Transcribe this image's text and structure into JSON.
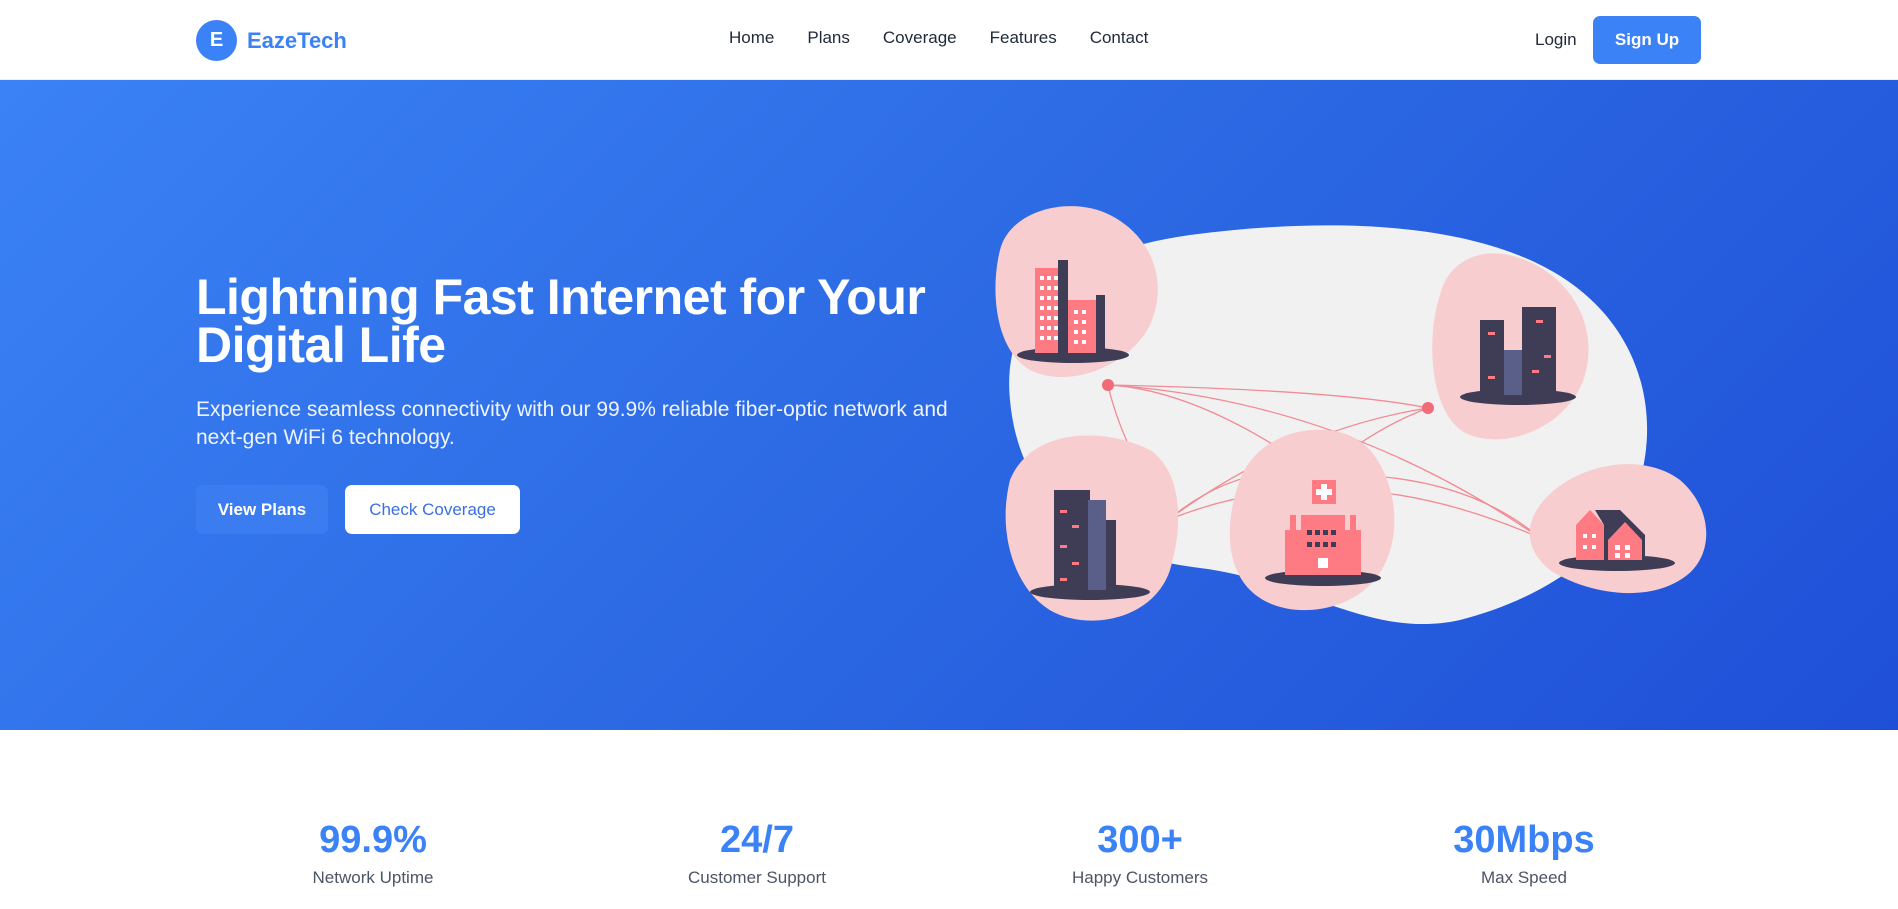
{
  "brand": {
    "logo_letter": "E",
    "name": "EazeTech",
    "accent": "#3b82f6"
  },
  "nav": {
    "items": [
      "Home",
      "Plans",
      "Coverage",
      "Features",
      "Contact"
    ]
  },
  "auth": {
    "login": "Login",
    "signup": "Sign Up"
  },
  "hero": {
    "title": "Lightning Fast Internet for Your Digital Life",
    "subtitle": "Experience seamless connectivity with our 99.9% reliable fiber-optic network and next-gen WiFi 6 technology.",
    "primary_button": "View Plans",
    "secondary_button": "Check Coverage",
    "illustration": "network-illustration"
  },
  "stats": [
    {
      "value": "99.9%",
      "label": "Network Uptime"
    },
    {
      "value": "24/7",
      "label": "Customer Support"
    },
    {
      "value": "300+",
      "label": "Happy Customers"
    },
    {
      "value": "30Mbps",
      "label": "Max Speed"
    }
  ]
}
